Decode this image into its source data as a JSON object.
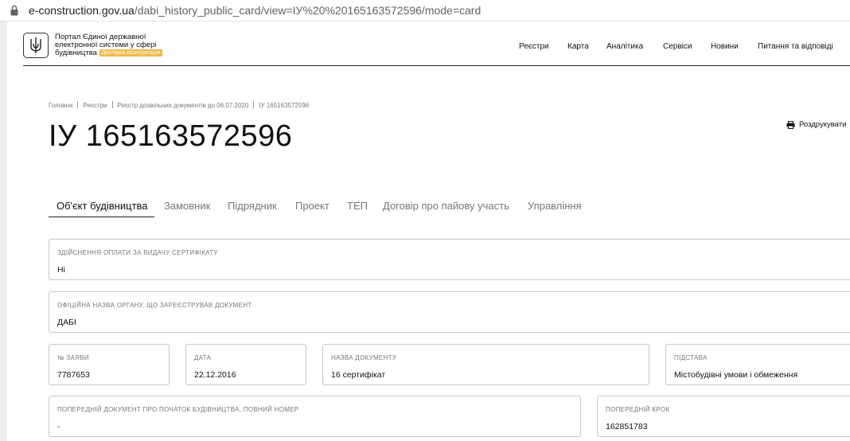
{
  "browser": {
    "url_host": "e-construction.gov.ua",
    "url_path": "/dabi_history_public_card/view=ІУ%20%20165163572596/mode=card"
  },
  "header": {
    "portal_name_line1": "Портал Єдиної державної",
    "portal_name_line2": "електронної системи у сфері",
    "portal_name_line3": "будівництва",
    "beta_badge": "Дослідна експлуатація",
    "nav": [
      "Реєстри",
      "Карта",
      "Аналітика",
      "Сервіси",
      "Новини",
      "Питання та відповіді"
    ]
  },
  "breadcrumb": [
    "Головна",
    "Реєстри",
    "Реєстр дозвільних документів до 06.07.2020",
    "ІУ 165163572596"
  ],
  "page_title": "ІУ 165163572596",
  "print_label": "Роздрукувати",
  "tabs": [
    "Об'єкт будівництва",
    "Замовник",
    "Підрядник",
    "Проект",
    "ТЕП",
    "Договір про пайову участь",
    "Управління"
  ],
  "active_tab": 0,
  "fields": {
    "payment": {
      "label": "Здійснення оплати за видачу сертифікату",
      "value": "Ні"
    },
    "authority": {
      "label": "Офіційна назва органу, що зареєстрував документ",
      "value": "ДАБІ"
    },
    "application_no": {
      "label": "№ заяви",
      "value": "7787653"
    },
    "date": {
      "label": "Дата",
      "value": "22.12.2016"
    },
    "doc_name": {
      "label": "Назва документу",
      "value": "16 сертифікат"
    },
    "basis": {
      "label": "Підстава",
      "value": "Містобудівні умови і обмеження"
    },
    "prev_doc": {
      "label": "Попередній документ про початок будівництва, повний номер",
      "value": "-"
    },
    "prev_step": {
      "label": "Попередній крок",
      "value": "162851783"
    }
  }
}
